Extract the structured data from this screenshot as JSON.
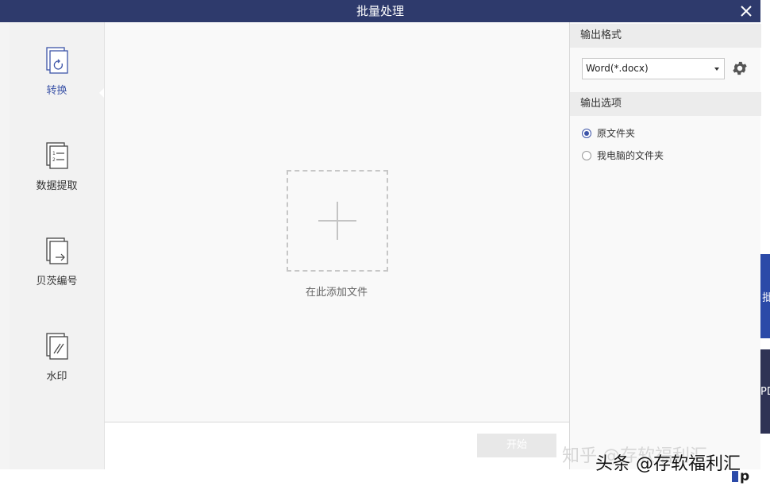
{
  "window": {
    "title": "批量处理"
  },
  "nav": {
    "items": [
      {
        "label": "转换",
        "icon": "convert-icon",
        "active": true
      },
      {
        "label": "数据提取",
        "icon": "data-extract-icon",
        "active": false
      },
      {
        "label": "贝茨编号",
        "icon": "bates-number-icon",
        "active": false
      },
      {
        "label": "水印",
        "icon": "watermark-icon",
        "active": false
      }
    ]
  },
  "center": {
    "drop_label": "在此添加文件",
    "start_label": "开始"
  },
  "right": {
    "format_header": "输出格式",
    "format_value": "Word(*.docx)",
    "options_header": "输出选项",
    "options": [
      {
        "label": "原文件夹",
        "checked": true
      },
      {
        "label": "我电脑的文件夹",
        "checked": false
      }
    ]
  },
  "background": {
    "tab1_text": "批",
    "tab2_text": "PD",
    "tab3_text": "p"
  },
  "watermark": {
    "ghost": "知乎 @存软福利汇",
    "text": "头条 @存软福利汇"
  },
  "colors": {
    "titlebar": "#2e3a6c",
    "accent": "#3d55a8"
  }
}
